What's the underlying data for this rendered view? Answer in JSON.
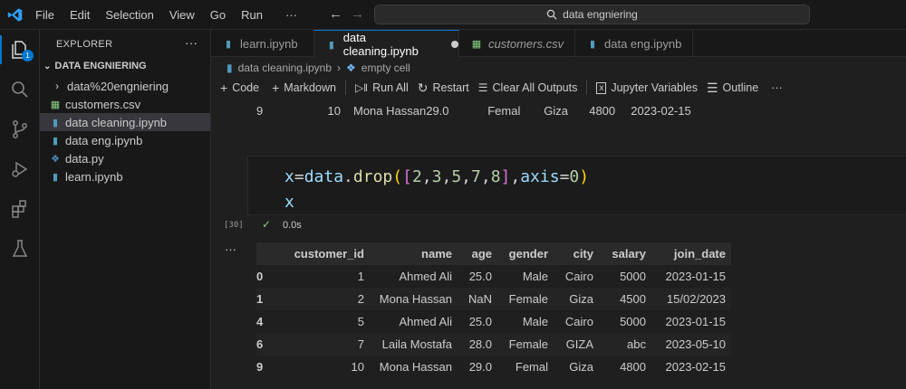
{
  "menu": {
    "items": [
      "File",
      "Edit",
      "Selection",
      "View",
      "Go",
      "Run",
      "···"
    ]
  },
  "search": {
    "text": "data engniering"
  },
  "explorer": {
    "title": "EXPLORER",
    "folder": "DATA ENGNIERING",
    "items": [
      {
        "label": "data%20engniering",
        "kind": "folder"
      },
      {
        "label": "customers.csv",
        "kind": "csv"
      },
      {
        "label": "data cleaning.ipynb",
        "kind": "ipynb",
        "selected": true
      },
      {
        "label": "data eng.ipynb",
        "kind": "ipynb"
      },
      {
        "label": "data.py",
        "kind": "py"
      },
      {
        "label": "learn.ipynb",
        "kind": "ipynb"
      }
    ],
    "badge": "1"
  },
  "tabs": [
    {
      "label": "learn.ipynb",
      "kind": "ipynb"
    },
    {
      "label": "data cleaning.ipynb",
      "kind": "ipynb",
      "active": true,
      "dirty": true
    },
    {
      "label": "customers.csv",
      "kind": "csv"
    },
    {
      "label": "data eng.ipynb",
      "kind": "ipynb"
    }
  ],
  "breadcrumb": {
    "file": "data cleaning.ipynb",
    "separator": "›",
    "cell": "empty cell"
  },
  "toolbar": {
    "code": "Code",
    "markdown": "Markdown",
    "run_all": "Run All",
    "restart": "Restart",
    "clear_all": "Clear All Outputs",
    "variables": "Jupyter Variables",
    "outline": "Outline",
    "more": "···"
  },
  "previous_output_row": [
    "9",
    "10",
    "Mona Hassan",
    "29.0",
    "Femal",
    "Giza",
    "4800",
    "2023-02-15"
  ],
  "cell": {
    "code_line_1": [
      {
        "t": "x",
        "c": "#9cdcfe"
      },
      {
        "t": "=",
        "c": "#d4d4d4"
      },
      {
        "t": "data",
        "c": "#9cdcfe"
      },
      {
        "t": ".",
        "c": "#d4d4d4"
      },
      {
        "t": "drop",
        "c": "#dcdcaa"
      },
      {
        "t": "(",
        "c": "#ffd700"
      },
      {
        "t": "[",
        "c": "#da70d6"
      },
      {
        "t": "2",
        "c": "#b5cea8"
      },
      {
        "t": ",",
        "c": "#d4d4d4"
      },
      {
        "t": "3",
        "c": "#b5cea8"
      },
      {
        "t": ",",
        "c": "#d4d4d4"
      },
      {
        "t": "5",
        "c": "#b5cea8"
      },
      {
        "t": ",",
        "c": "#d4d4d4"
      },
      {
        "t": "7",
        "c": "#b5cea8"
      },
      {
        "t": ",",
        "c": "#d4d4d4"
      },
      {
        "t": "8",
        "c": "#b5cea8"
      },
      {
        "t": "]",
        "c": "#da70d6"
      },
      {
        "t": ",",
        "c": "#d4d4d4"
      },
      {
        "t": "axis",
        "c": "#9cdcfe"
      },
      {
        "t": "=",
        "c": "#d4d4d4"
      },
      {
        "t": "0",
        "c": "#b5cea8"
      },
      {
        "t": ")",
        "c": "#ffd700"
      }
    ],
    "code_line_2": "x",
    "exec_count": "[30]",
    "exec_time": "0.0s",
    "output_more": "···"
  },
  "output_table": {
    "columns": [
      "",
      "customer_id",
      "name",
      "age",
      "gender",
      "city",
      "salary",
      "join_date"
    ],
    "rows": [
      [
        "0",
        "1",
        "Ahmed Ali",
        "25.0",
        "Male",
        "Cairo",
        "5000",
        "2023-01-15"
      ],
      [
        "1",
        "2",
        "Mona Hassan",
        "NaN",
        "Female",
        "Giza",
        "4500",
        "15/02/2023"
      ],
      [
        "4",
        "5",
        "Ahmed Ali",
        "25.0",
        "Male",
        "Cairo",
        "5000",
        "2023-01-15"
      ],
      [
        "6",
        "7",
        "Laila Mostafa",
        "28.0",
        "Female",
        "GIZA",
        "abc",
        "2023-05-10"
      ],
      [
        "9",
        "10",
        "Mona Hassan",
        "29.0",
        "Femal",
        "Giza",
        "4800",
        "2023-02-15"
      ]
    ]
  },
  "colors": {
    "accent": "#0078d4",
    "background": "#1f1f1f",
    "sidebar": "#181818"
  }
}
